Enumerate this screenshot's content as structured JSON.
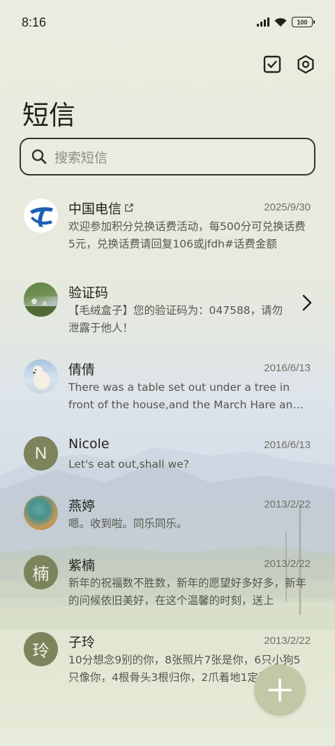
{
  "status_bar": {
    "time": "8:16",
    "battery": "100",
    "icons": [
      "signal-icon",
      "wifi-icon",
      "battery-icon"
    ]
  },
  "header": {
    "title": "短信",
    "actions": [
      "select-icon",
      "settings-icon"
    ]
  },
  "search": {
    "placeholder": "搜索短信"
  },
  "conversations": [
    {
      "name": "中国电信",
      "date": "2025/9/30",
      "preview": "欢迎参加积分兑换话费活动，每500分可兑换话费5元，兑换话费请回复106或jfdh#话费金额",
      "avatar": "china-telecom-logo"
    },
    {
      "name": "验证码",
      "date": "",
      "preview": "【毛绒盒子】您的验证码为：047588，请勿泄露于他人！",
      "avatar": "photo"
    },
    {
      "name": "倩倩",
      "date": "2016/6/13",
      "preview": "There was a table set out under a tree in front of the house,and the March Hare and the Hatter",
      "avatar": "polar-bear-photo"
    },
    {
      "name": "Nicole",
      "date": "2016/6/13",
      "preview": "Let's eat out,shall we?",
      "avatar_letter": "N"
    },
    {
      "name": "燕婷",
      "date": "2013/2/22",
      "preview": "嗯。收到啦。同乐同乐。",
      "avatar": "photo"
    },
    {
      "name": "紫楠",
      "date": "2013/2/22",
      "preview": "新年的祝福数不胜数，新年的愿望好多好多，新年的问候依旧美好，在这个温馨的时刻，送上",
      "avatar_letter": "楠"
    },
    {
      "name": "子玲",
      "date": "2013/2/22",
      "preview": "10分想念9别的你，8张照片7张是你，6只小狗5只像你，4根骨头3根归你，2爪着地1定是你",
      "avatar_letter": "玲"
    }
  ],
  "fab": {
    "icon": "plus-icon"
  },
  "colors": {
    "accent": "#7c845c",
    "fab": "#c3c7a6",
    "background": "#eaecdf"
  }
}
